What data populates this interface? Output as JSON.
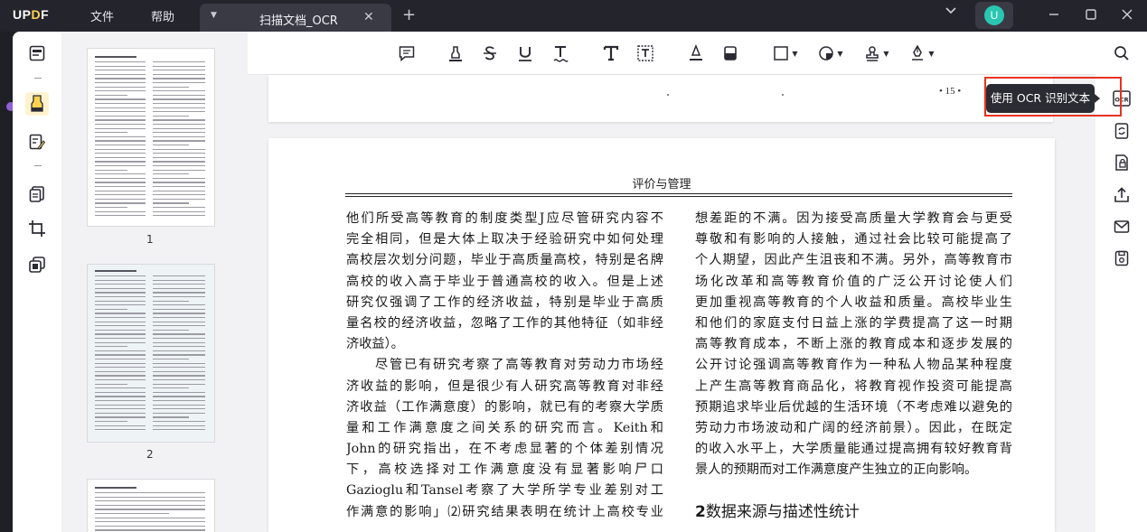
{
  "app": {
    "logo_text": "UPDF"
  },
  "menu": {
    "file": "文件",
    "help": "帮助"
  },
  "tab": {
    "title": "扫描文档_OCR"
  },
  "user": {
    "avatar_letter": "U"
  },
  "colors": {
    "accent_yellow": "#ffd34f",
    "avatar": "#29c7b0",
    "highlight_red": "#e8331d"
  },
  "left_tools": [
    "reader-icon",
    "highlight-tool-icon",
    "edit-pdf-icon",
    "pages-icon",
    "crop-icon",
    "layers-icon"
  ],
  "thumbnails": [
    {
      "number": "1"
    },
    {
      "number": "2"
    }
  ],
  "toolbar_tools": [
    "comment-icon",
    "highlight-pen-icon",
    "strikethrough-icon",
    "underline-icon",
    "squiggly-icon",
    "text-icon",
    "textbox-icon",
    "pencil-icon",
    "eraser-icon",
    "shape-icon",
    "sticker-icon",
    "stamp-icon",
    "signature-icon"
  ],
  "right_tools": [
    "search-icon",
    "ocr-icon",
    "convert-icon",
    "protect-icon",
    "share-icon",
    "mail-icon",
    "save-icon"
  ],
  "tooltip": {
    "text": "使用 OCR 识别文本"
  },
  "document": {
    "prev_page_number": "• 15 •",
    "header": "评价与管理",
    "left_column": [
      "他们所受高等教育的制度类型J应尽管研究内容不",
      "完全相同，但是大体上取决于经验研究中如何处理",
      "高校层次划分问题，毕业于高质量高校，特别是名牌",
      "高校的收入高于毕业于普通高校的收入。但是上述",
      "研究仅强调了工作的经济收益，特别是毕业于高质",
      "量名校的经济收益，忽略了工作的其他特征（如非经",
      "济收益）。",
      "尽管已有研究考察了高等教育对劳动力市场经",
      "济收益的影响，但是很少有人研究高等教育对非经",
      "济收益（工作满意度）的影响，就已有的考察大学质",
      "量和工作满意度之间关系的研究而言。Keith和",
      "John的研究指出，在不考虑显著的个体差别情况",
      "下，高校选择对工作满意度没有显著影响尸口",
      "Gazioglu和Tansel考察了大学所学专业差别对工",
      "作满意的影响」⑵研究结果表明在统计上高校专业"
    ],
    "right_column": [
      "想差距的不满。因为接受高质量大学教育会与更受",
      "尊敬和有影响的人接触，通过社会比较可能提高了",
      "个人期望，因此产生沮丧和不满。另外，高等教育市",
      "场化改革和高等教育价值的广泛公开讨论使人们",
      "更加重视高等教育的个人收益和质量。高校毕业生",
      "和他们的家庭支付日益上涨的学费提高了这一时期",
      "高等教育成本，不断上涨的教育成本和逐步发展的",
      "公开讨论强调高等教育作为一种私人物品某种程度",
      "上产生高等教育商品化，将教育视作投资可能提高",
      "预期追求毕业后优越的生活环境（不考虑难以避免的",
      "劳动力市场波动和广阔的经济前景）。因此，在既定",
      "的收入水平上，大学质量能通过提高拥有较好教育背",
      "景人的预期而对工作满意度产生独立的正向影响。"
    ],
    "section_number": "2",
    "section_title": "数据来源与描述性统计"
  }
}
